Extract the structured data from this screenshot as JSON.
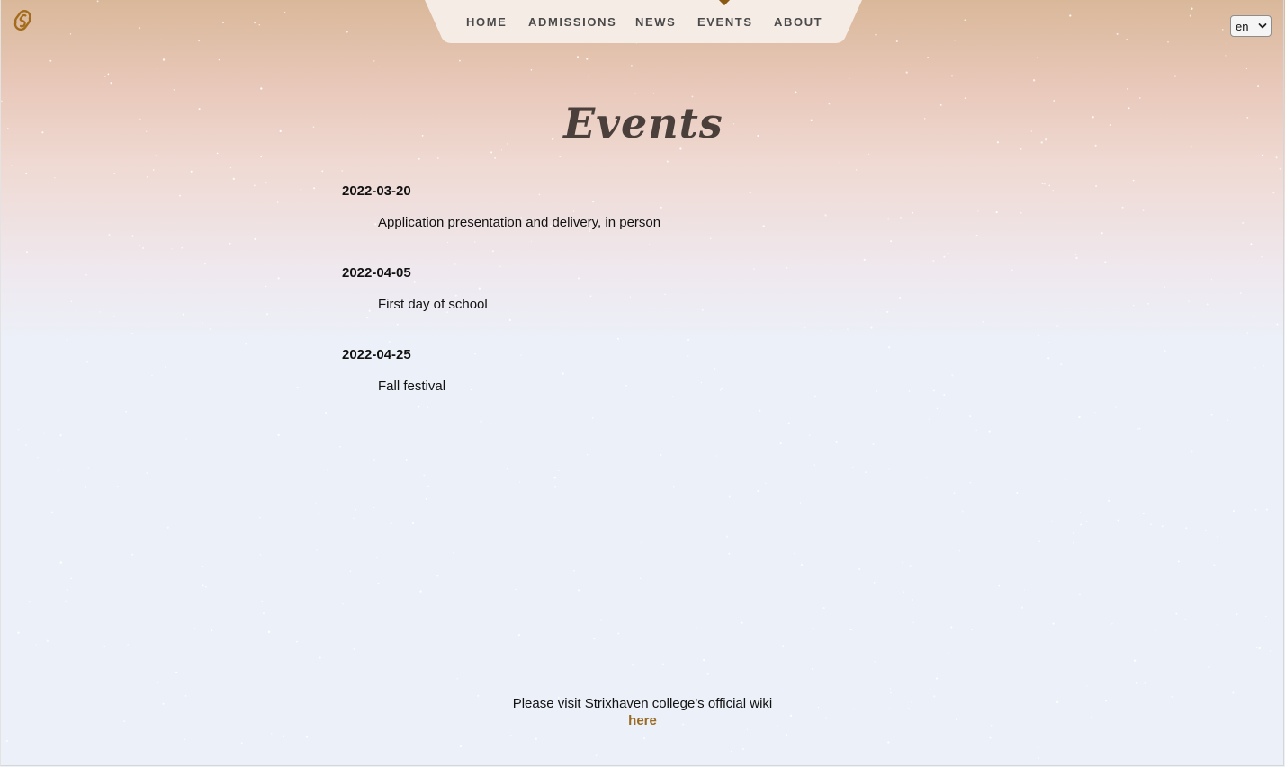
{
  "logo": {
    "icon": "svelte-logo-icon",
    "color": "#a36b1c"
  },
  "nav": {
    "items": [
      {
        "label": "HOME",
        "active": false
      },
      {
        "label": "ADMISSIONS",
        "active": false
      },
      {
        "label": "NEWS",
        "active": false
      },
      {
        "label": "EVENTS",
        "active": true
      },
      {
        "label": "ABOUT",
        "active": false
      }
    ],
    "active_marker_color": "#8a5a14"
  },
  "language_select": {
    "selected": "en"
  },
  "page": {
    "title": "Events"
  },
  "events": [
    {
      "date": "2022-03-20",
      "description": "Application presentation and delivery, in person"
    },
    {
      "date": "2022-04-05",
      "description": "First day of school"
    },
    {
      "date": "2022-04-25",
      "description": "Fall festival"
    }
  ],
  "footer": {
    "text": "Please visit Strixhaven college's official wiki",
    "link_label": "here",
    "link_color": "#9a6a22"
  }
}
